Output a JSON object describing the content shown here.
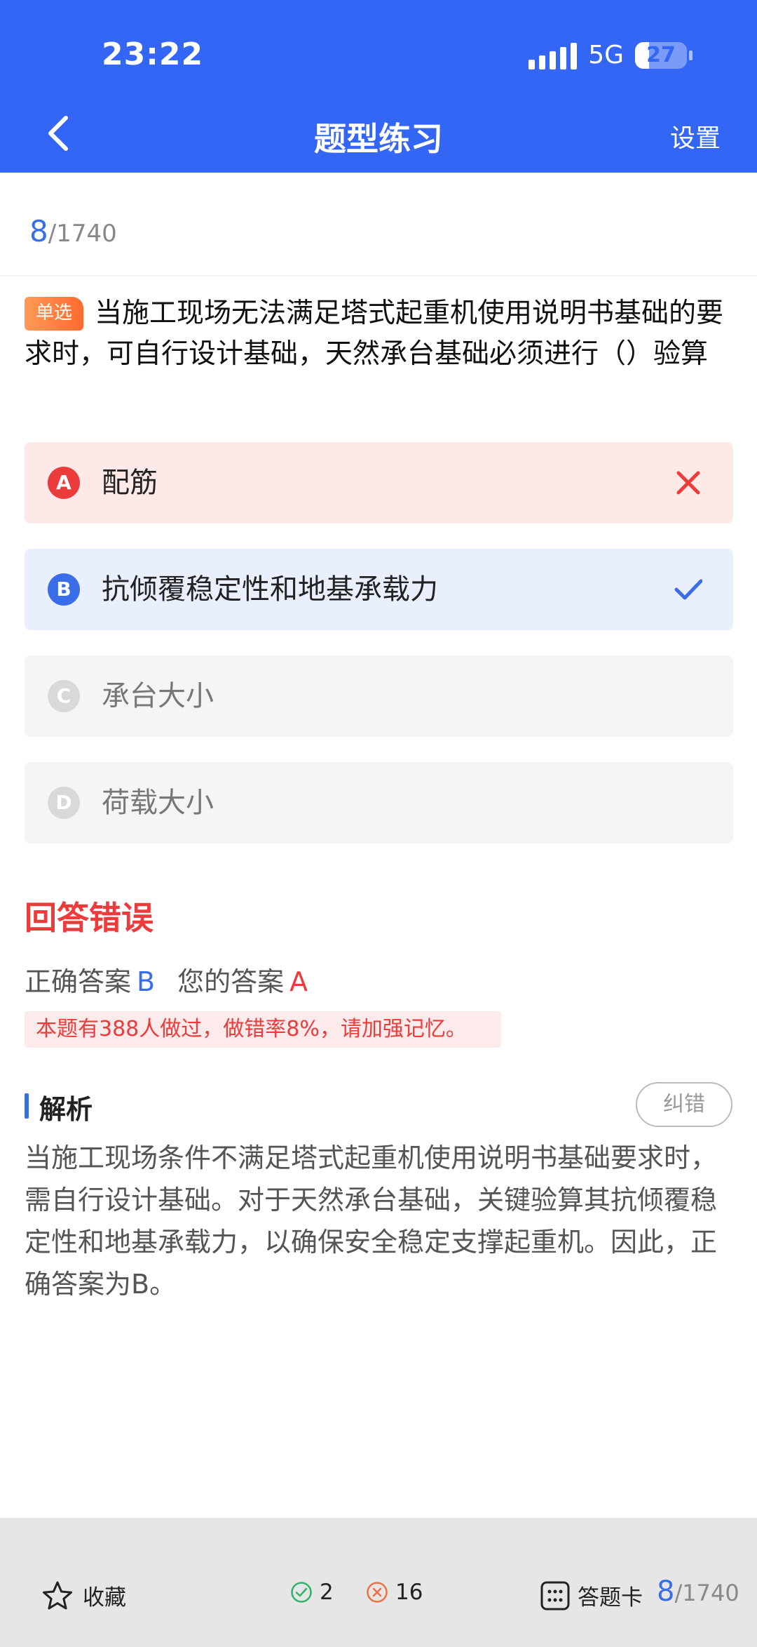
{
  "status_bar": {
    "time": "23:22",
    "network": "5G",
    "battery_level": "27"
  },
  "nav": {
    "title": "题型练习",
    "settings_label": "设置"
  },
  "progress": {
    "current": "8",
    "total": "/1740"
  },
  "question": {
    "type_label": "单选",
    "text": "当施工现场无法满足塔式起重机使用说明书基础的要求时，可自行设计基础，天然承台基础必须进行（）验算"
  },
  "options": [
    {
      "letter": "A",
      "text": "配筋",
      "state": "wrong"
    },
    {
      "letter": "B",
      "text": "抗倾覆稳定性和地基承载力",
      "state": "correct"
    },
    {
      "letter": "C",
      "text": "承台大小",
      "state": "normal"
    },
    {
      "letter": "D",
      "text": "荷载大小",
      "state": "normal"
    }
  ],
  "result": {
    "title": "回答错误",
    "correct_label": "正确答案",
    "correct_value": "B",
    "yours_label": "您的答案",
    "yours_value": "A",
    "stat_text": "本题有388人做过，做错率8%，请加强记忆。"
  },
  "analysis": {
    "title": "解析",
    "report_label": "纠错",
    "body": "当施工现场条件不满足塔式起重机使用说明书基础要求时，需自行设计基础。对于天然承台基础，关键验算其抗倾覆稳定性和地基承载力，以确保安全稳定支撑起重机。因此，正确答案为B。"
  },
  "bottom_bar": {
    "favorite_label": "收藏",
    "correct_count": "2",
    "wrong_count": "16",
    "card_label": "答题卡",
    "progress_current": "8",
    "progress_total": "/1740"
  },
  "colors": {
    "primary": "#3366f4",
    "error": "#ec3b3b",
    "accent_blue": "#3a6ee8"
  },
  "icons": {
    "back": "chevron-left-icon",
    "wrong": "cross-icon",
    "right": "check-icon",
    "favorite": "star-icon",
    "card": "grid-icon"
  }
}
